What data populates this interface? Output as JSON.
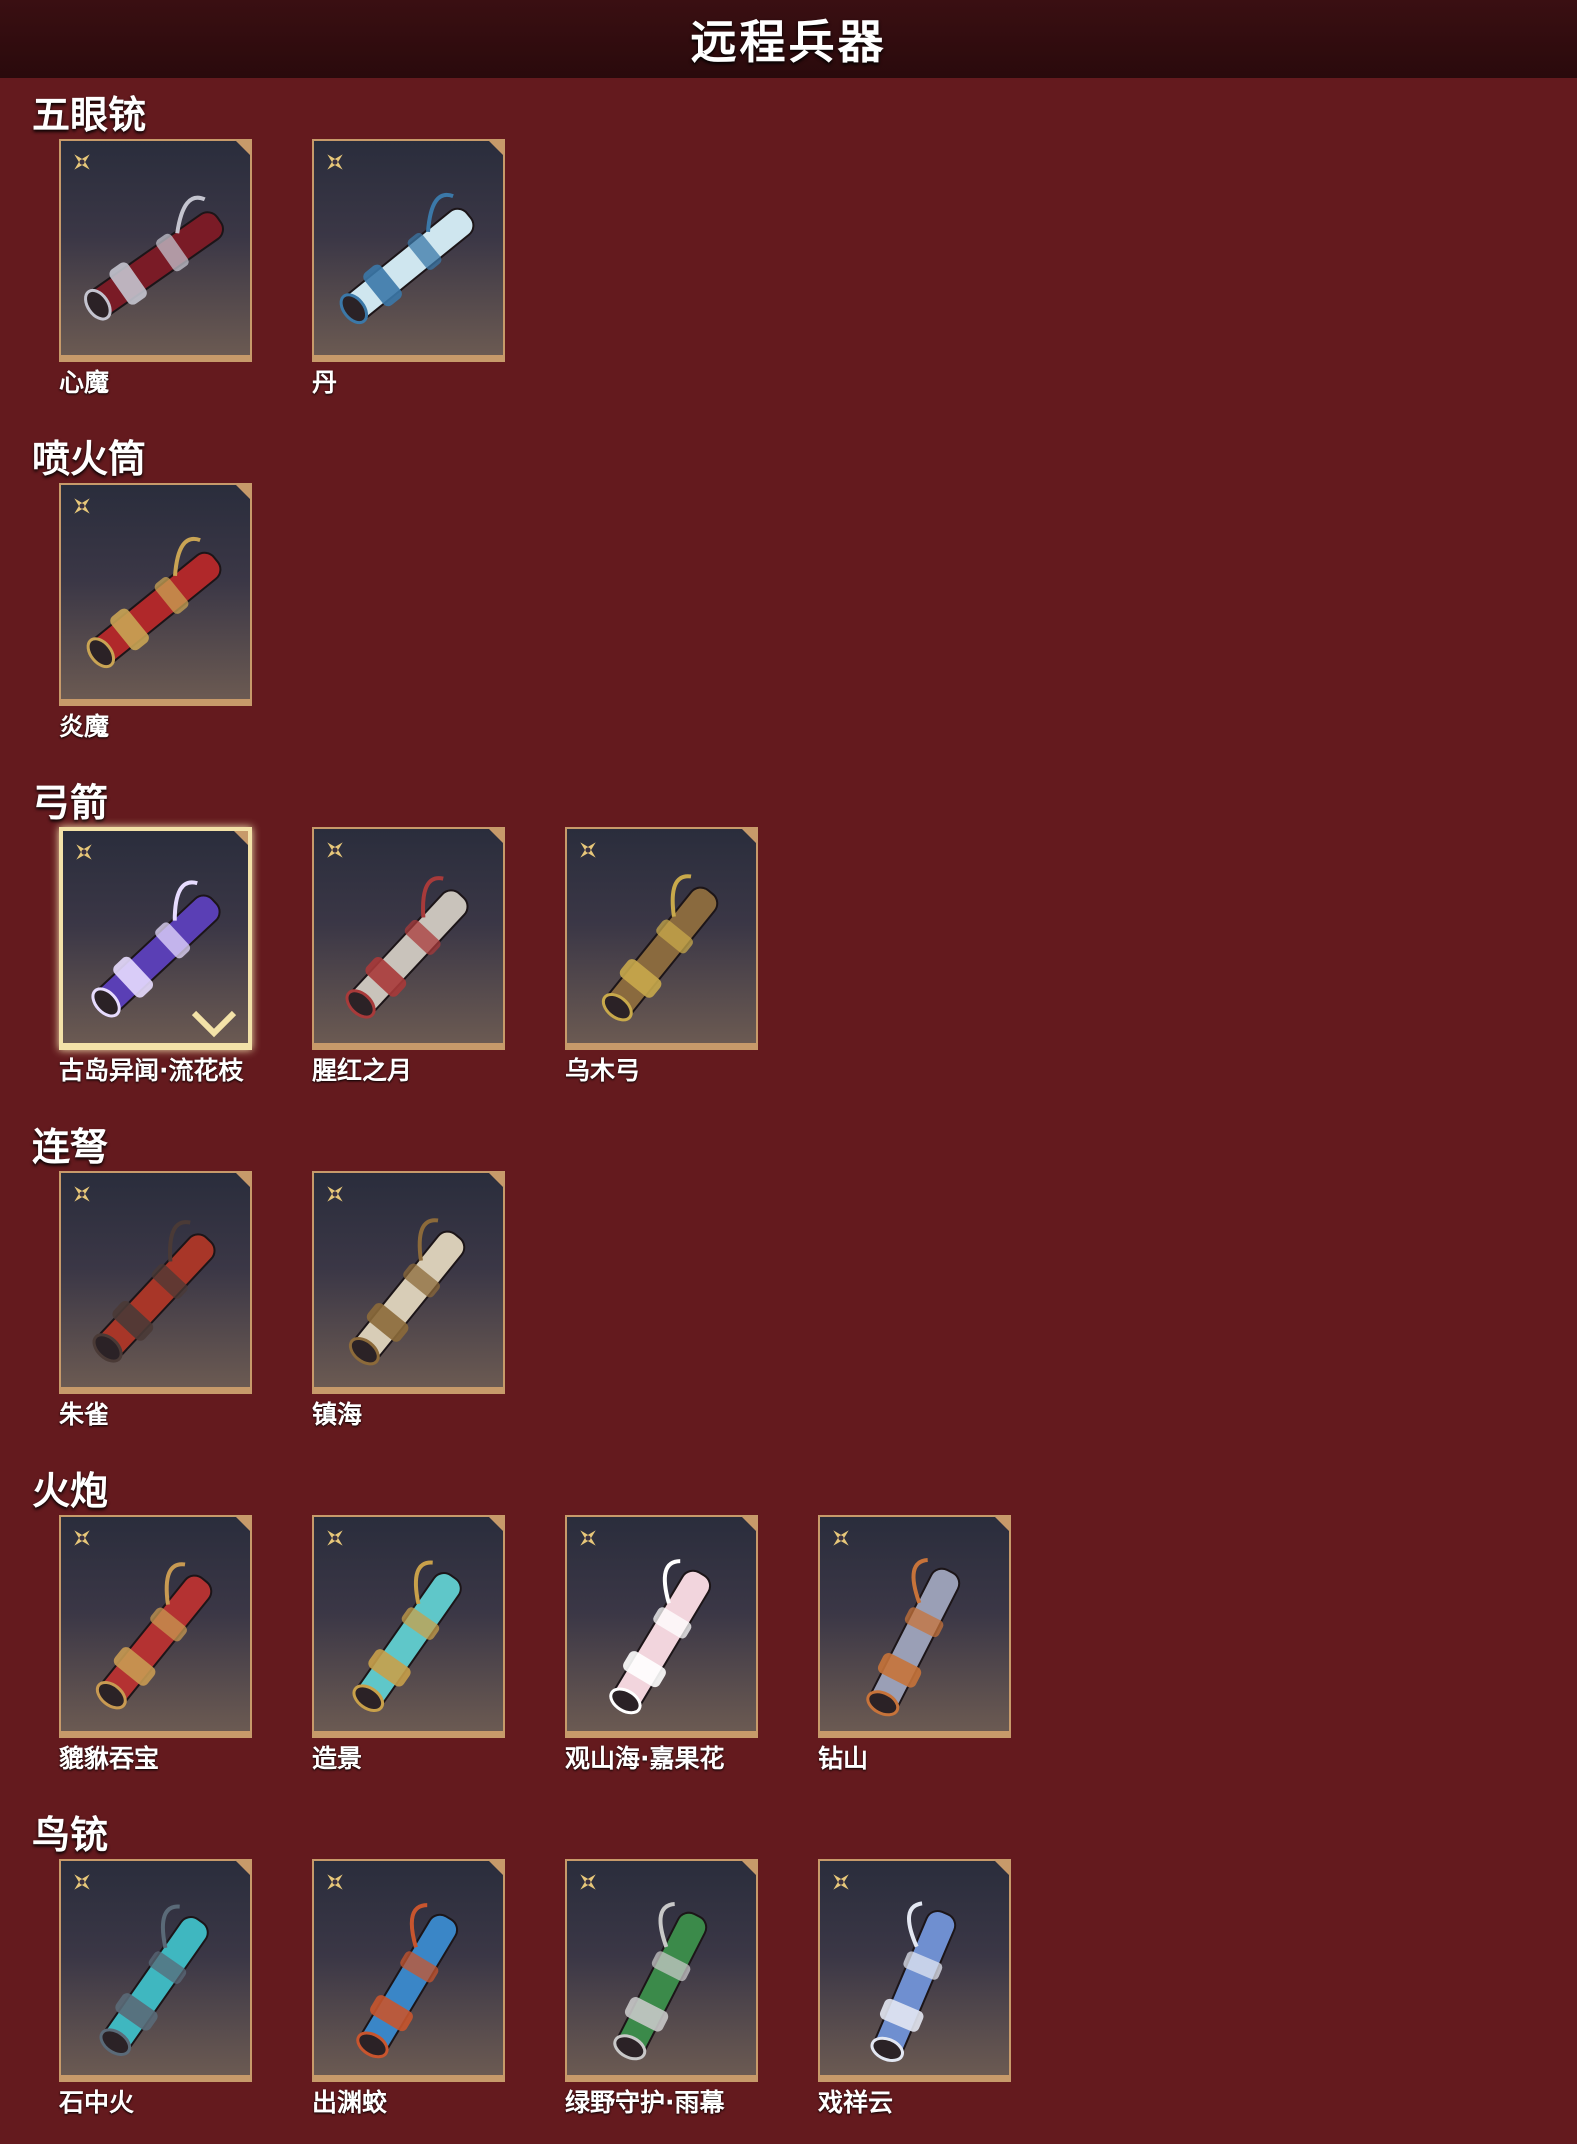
{
  "header": {
    "title": "远程兵器"
  },
  "categories": [
    {
      "title": "五眼铳",
      "items": [
        {
          "name": "心魔",
          "colors": [
            "#7a1b26",
            "#c4c4cf"
          ]
        },
        {
          "name": "丹",
          "colors": [
            "#cfe6ef",
            "#3b78a8"
          ]
        }
      ]
    },
    {
      "title": "喷火筒",
      "items": [
        {
          "name": "炎魔",
          "colors": [
            "#b0282a",
            "#c9a454"
          ]
        }
      ]
    },
    {
      "title": "弓箭",
      "items": [
        {
          "name": "古岛异闻·流花枝",
          "colors": [
            "#5a3fb5",
            "#e7dcff"
          ],
          "selected": true
        },
        {
          "name": "腥红之月",
          "colors": [
            "#c9c3bb",
            "#a83a3a"
          ]
        },
        {
          "name": "乌木弓",
          "colors": [
            "#8a6a3e",
            "#c8a94b"
          ]
        }
      ]
    },
    {
      "title": "连弩",
      "items": [
        {
          "name": "朱雀",
          "colors": [
            "#a83628",
            "#4a3a36"
          ]
        },
        {
          "name": "镇海",
          "colors": [
            "#d8cdb7",
            "#8c6a3a"
          ]
        }
      ]
    },
    {
      "title": "火炮",
      "items": [
        {
          "name": "貔貅吞宝",
          "colors": [
            "#b43232",
            "#c89a52"
          ]
        },
        {
          "name": "造景",
          "colors": [
            "#5fc7c9",
            "#c8a04a"
          ]
        },
        {
          "name": "观山海·嘉果花",
          "colors": [
            "#f2d5dd",
            "#ffffff"
          ]
        },
        {
          "name": "钻山",
          "colors": [
            "#9a9fb6",
            "#c7733a"
          ]
        }
      ]
    },
    {
      "title": "鸟铳",
      "items": [
        {
          "name": "石中火",
          "colors": [
            "#3fb7c0",
            "#5a6a78"
          ]
        },
        {
          "name": "出渊蛟",
          "colors": [
            "#3a86c7",
            "#c8552e"
          ]
        },
        {
          "name": "绿野守护·雨幕",
          "colors": [
            "#3b8a4a",
            "#c8c8c8"
          ]
        },
        {
          "name": "戏祥云",
          "colors": [
            "#6f8fd0",
            "#e3e7f2"
          ]
        }
      ]
    }
  ],
  "icons": {
    "rank": "sparkle-rank-icon",
    "selected": "check-icon"
  },
  "theme": {
    "background": "#641a1e",
    "card_border": "#c79a6a",
    "rank_icon": "#e8c87a"
  }
}
